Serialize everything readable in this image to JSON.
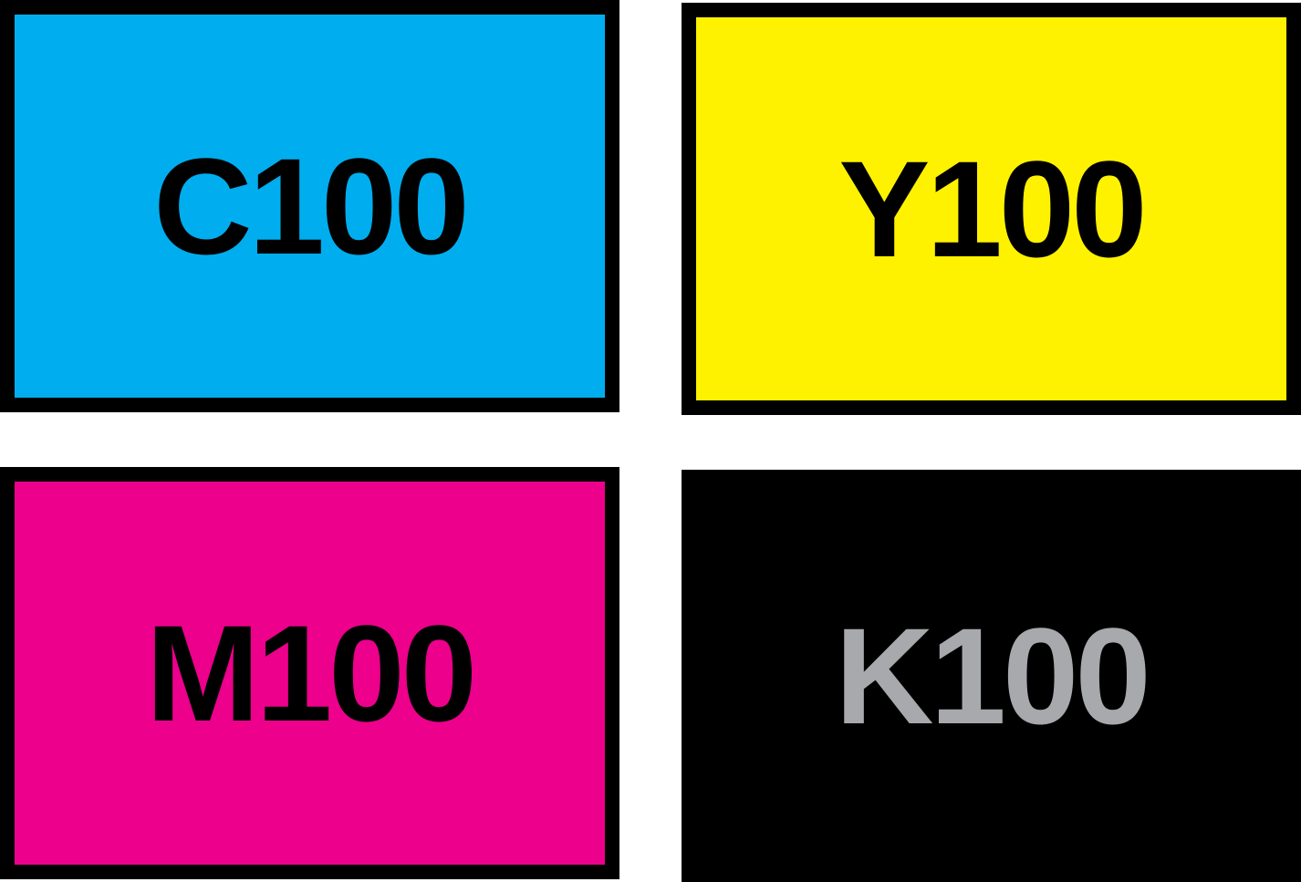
{
  "swatches": [
    {
      "label": "C100",
      "fill": "#00AEEF",
      "text_color": "#000000",
      "border": "#000000"
    },
    {
      "label": "Y100",
      "fill": "#FFF200",
      "text_color": "#000000",
      "border": "#000000"
    },
    {
      "label": "M100",
      "fill": "#EC008C",
      "text_color": "#000000",
      "border": "#000000"
    },
    {
      "label": "K100",
      "fill": "#000000",
      "text_color": "#A7A9AC",
      "border": "#000000"
    }
  ]
}
